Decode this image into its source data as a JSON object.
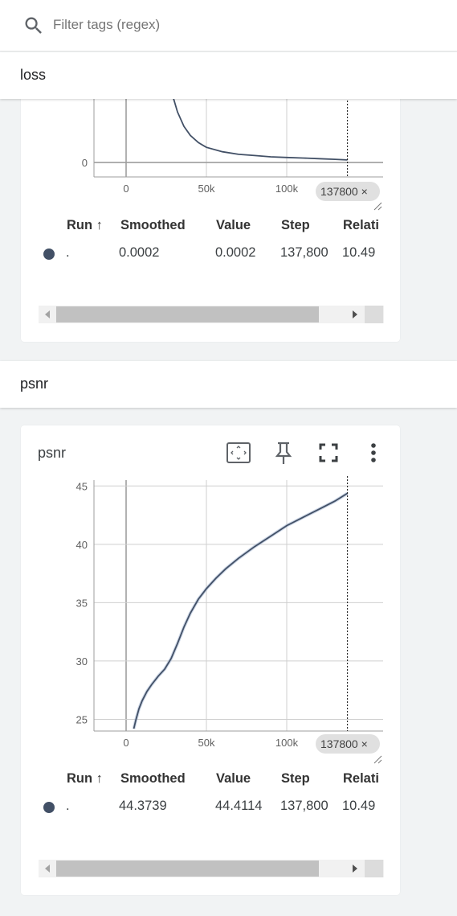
{
  "filter": {
    "placeholder": "Filter tags (regex)",
    "icon": "search-icon"
  },
  "groups": [
    {
      "title": "loss",
      "card": {
        "x_ticks": [
          "0",
          "50k",
          "100k"
        ],
        "y_ticks": [
          "0"
        ],
        "step_chip": "137800 ×",
        "table": {
          "headers": [
            "Run ↑",
            "Smoothed",
            "Value",
            "Step",
            "Relativ"
          ],
          "rows": [
            {
              "run": ".",
              "smoothed": "0.0002",
              "value": "0.0002",
              "step": "137,800",
              "relative": "10.49"
            }
          ]
        }
      }
    },
    {
      "title": "psnr",
      "card": {
        "title": "psnr",
        "toolbar_icons": [
          "fit-domain-icon",
          "pin-icon",
          "fullscreen-icon",
          "more-vert-icon"
        ],
        "x_ticks": [
          "0",
          "50k",
          "100k"
        ],
        "y_ticks": [
          "45",
          "40",
          "35",
          "30",
          "25"
        ],
        "step_chip": "137800 ×",
        "table": {
          "headers": [
            "Run ↑",
            "Smoothed",
            "Value",
            "Step",
            "Relativ"
          ],
          "rows": [
            {
              "run": ".",
              "smoothed": "44.3739",
              "value": "44.4114",
              "step": "137,800",
              "relative": "10.49"
            }
          ]
        }
      }
    }
  ],
  "colors": {
    "series": "#425066",
    "series_raw": "#aabbd6",
    "accent_grid": "#cfcfcf"
  },
  "chart_data": [
    {
      "type": "line",
      "title": "",
      "xlabel": "",
      "ylabel": "",
      "x_ticks": [
        0,
        50000,
        100000
      ],
      "y_ticks": [
        0
      ],
      "xlim": [
        -20000,
        160000
      ],
      "cursor_step": 137800,
      "series": [
        {
          "x": [
            28000,
            32000,
            36000,
            40000,
            45000,
            50000,
            60000,
            70000,
            80000,
            90000,
            100000,
            110000,
            120000,
            130000,
            137800
          ],
          "values": [
            0.08,
            0.056,
            0.04,
            0.03,
            0.022,
            0.0168,
            0.0119,
            0.009,
            0.0077,
            0.0063,
            0.0056,
            0.0049,
            0.0042,
            0.0035,
            0.0028
          ]
        }
      ]
    },
    {
      "type": "line",
      "title": "psnr",
      "xlabel": "",
      "ylabel": "",
      "x_ticks": [
        0,
        50000,
        100000
      ],
      "y_ticks": [
        25,
        30,
        35,
        40,
        45
      ],
      "xlim": [
        -20000,
        160000
      ],
      "ylim": [
        24,
        45.5
      ],
      "cursor_step": 137800,
      "series": [
        {
          "x": [
            4800,
            6000,
            8000,
            10000,
            13000,
            16000,
            20000,
            24000,
            28000,
            32000,
            36000,
            40000,
            45000,
            50000,
            56000,
            62000,
            70000,
            80000,
            90000,
            100000,
            110000,
            120000,
            130000,
            137800
          ],
          "values": [
            24.2,
            24.9,
            25.9,
            26.6,
            27.4,
            28.0,
            28.7,
            29.3,
            30.2,
            31.5,
            32.9,
            34.1,
            35.3,
            36.2,
            37.1,
            37.9,
            38.8,
            39.8,
            40.7,
            41.6,
            42.3,
            43.0,
            43.7,
            44.37
          ]
        }
      ]
    }
  ]
}
